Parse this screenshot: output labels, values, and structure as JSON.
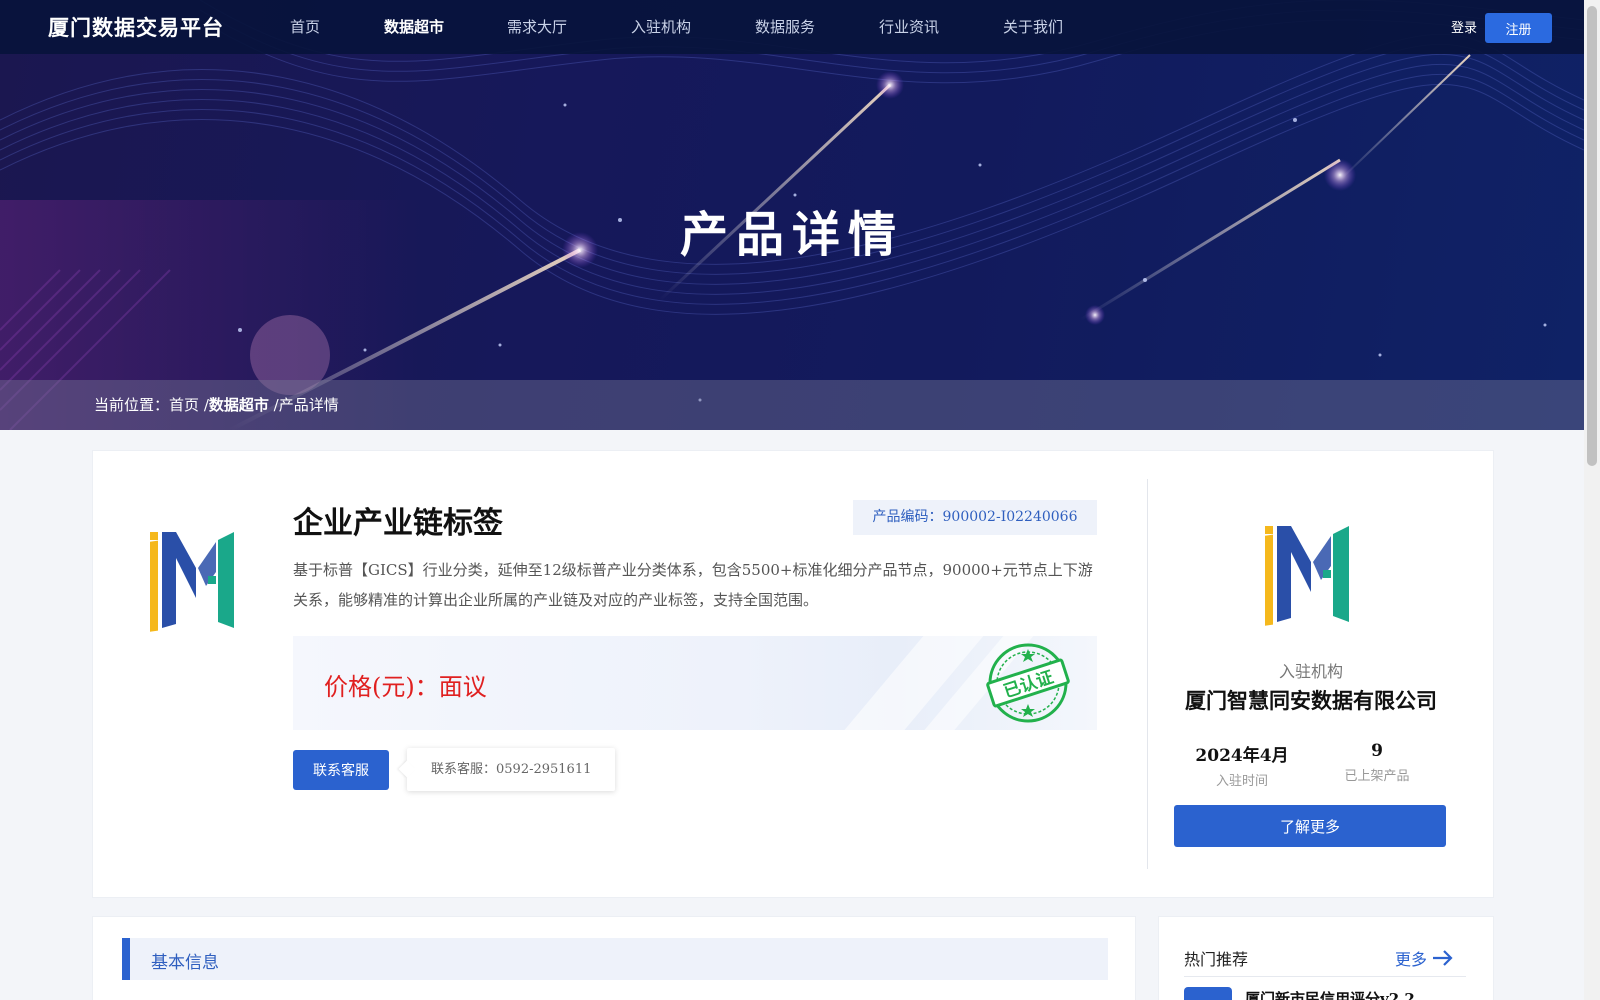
{
  "nav": {
    "logo": "厦门数据交易平台",
    "items": [
      {
        "label": "首页",
        "active": false
      },
      {
        "label": "数据超市",
        "active": true
      },
      {
        "label": "需求大厅",
        "active": false
      },
      {
        "label": "入驻机构",
        "active": false
      },
      {
        "label": "数据服务",
        "active": false
      },
      {
        "label": "行业资讯",
        "active": false
      },
      {
        "label": "关于我们",
        "active": false
      }
    ],
    "login": "登录",
    "register": "注册"
  },
  "banner": {
    "title": "产品详情"
  },
  "breadcrumb": {
    "prefix": "当前位置：",
    "home": "首页",
    "sep1": "/",
    "section": "数据超市",
    "sep2": "/",
    "current": "产品详情"
  },
  "product": {
    "title": "企业产业链标签",
    "code": "产品编码：900002-I02240066",
    "description": "基于标普【GICS】行业分类，延伸至12级标普产业分类体系，包含5500+标准化细分产品节点，90000+元节点上下游关系，能够精准的计算出企业所属的产业链及对应的产业标签，支持全国范围。",
    "price": "价格(元)：面议",
    "stamp_text": "已认证",
    "contact_button": "联系客服",
    "contact_tip": "联系客服：0592-2951611"
  },
  "org": {
    "label": "入驻机构",
    "name": "厦门智慧同安数据有限公司",
    "join_date_value": "2024年4月",
    "join_date_label": "入驻时间",
    "products_value": "9",
    "products_label": "已上架产品",
    "learn_more": "了解更多"
  },
  "basic_info": {
    "title": "基本信息"
  },
  "hot": {
    "title": "热门推荐",
    "more": "更多",
    "first_item": "厦门新市民信用评分v2.2"
  },
  "colors": {
    "accent": "#2b62cf",
    "price": "#e02020",
    "stamp": "#22b14c",
    "logo_yellow": "#f5b81c",
    "logo_blue": "#2a4fa8",
    "logo_teal": "#1aa88a"
  },
  "icons": {
    "more_arrow": "arrow-right-icon",
    "verified": "verified-stamp-icon"
  }
}
